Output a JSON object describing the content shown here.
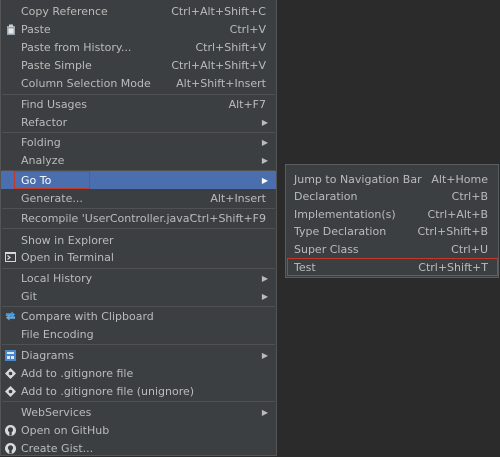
{
  "main_menu": [
    {
      "label": "Copy Reference",
      "shortcut": "Ctrl+Alt+Shift+C"
    },
    {
      "label": "Paste",
      "shortcut": "Ctrl+V",
      "icon": "paste-icon"
    },
    {
      "label": "Paste from History...",
      "shortcut": "Ctrl+Shift+V"
    },
    {
      "label": "Paste Simple",
      "shortcut": "Ctrl+Alt+Shift+V"
    },
    {
      "label": "Column Selection Mode",
      "shortcut": "Alt+Shift+Insert"
    },
    {
      "label": "Find Usages",
      "shortcut": "Alt+F7"
    },
    {
      "label": "Refactor",
      "submenu": true
    },
    {
      "label": "Folding",
      "submenu": true
    },
    {
      "label": "Analyze",
      "submenu": true
    },
    {
      "label": "Go To",
      "submenu": true,
      "active": true
    },
    {
      "label": "Generate...",
      "shortcut": "Alt+Insert"
    },
    {
      "label": "Recompile 'UserController.java'",
      "shortcut": "Ctrl+Shift+F9"
    },
    {
      "label": "Show in Explorer"
    },
    {
      "label": "Open in Terminal",
      "icon": "terminal-icon"
    },
    {
      "label": "Local History",
      "submenu": true
    },
    {
      "label": "Git",
      "submenu": true
    },
    {
      "label": "Compare with Clipboard",
      "icon": "compare-icon"
    },
    {
      "label": "File Encoding"
    },
    {
      "label": "Diagrams",
      "submenu": true,
      "icon": "diagram-icon"
    },
    {
      "label": "Add to .gitignore file",
      "icon": "gitignore-icon"
    },
    {
      "label": "Add to .gitignore file (unignore)",
      "icon": "gitignore-icon"
    },
    {
      "label": "WebServices",
      "submenu": true
    },
    {
      "label": "Open on GitHub",
      "icon": "github-icon"
    },
    {
      "label": "Create Gist...",
      "icon": "github-icon"
    }
  ],
  "goto_submenu": [
    {
      "label": "Jump to Navigation Bar",
      "shortcut": "Alt+Home"
    },
    {
      "label": "Declaration",
      "shortcut": "Ctrl+B"
    },
    {
      "label": "Implementation(s)",
      "shortcut": "Ctrl+Alt+B"
    },
    {
      "label": "Type Declaration",
      "shortcut": "Ctrl+Shift+B"
    },
    {
      "label": "Super Class",
      "shortcut": "Ctrl+U"
    },
    {
      "label": "Test",
      "shortcut": "Ctrl+Shift+T"
    }
  ],
  "submenu_arrow": "▶",
  "colors": {
    "menu_bg": "#3c3f41",
    "editor_bg": "#2b2b2b",
    "active_bg": "#4b6eaf",
    "highlight_box": "#c0392b",
    "text": "#bbbbbb"
  }
}
